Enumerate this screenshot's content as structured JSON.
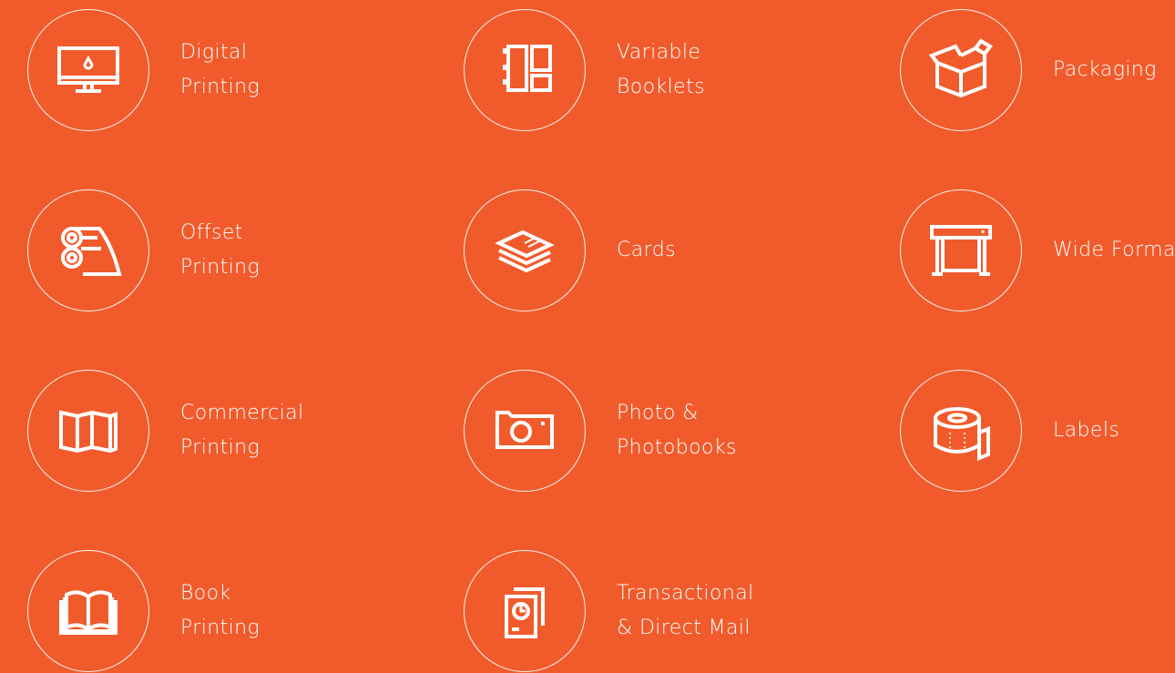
{
  "categories": [
    {
      "id": "digital-printing",
      "icon": "monitor-icon",
      "lines": [
        "Digital",
        "Printing"
      ]
    },
    {
      "id": "variable-booklets",
      "icon": "booklet-layout-icon",
      "lines": [
        "Variable",
        "Booklets"
      ]
    },
    {
      "id": "packaging",
      "icon": "box-icon",
      "lines": [
        "Packaging"
      ]
    },
    {
      "id": "offset-printing",
      "icon": "offset-rollers-icon",
      "lines": [
        "Offset",
        "Printing"
      ]
    },
    {
      "id": "cards",
      "icon": "card-stack-icon",
      "lines": [
        "Cards"
      ]
    },
    {
      "id": "wide-format",
      "icon": "wide-format-printer-icon",
      "lines": [
        "Wide Format"
      ]
    },
    {
      "id": "commercial-printing",
      "icon": "folded-map-icon",
      "lines": [
        "Commercial",
        "Printing"
      ]
    },
    {
      "id": "photo-photobooks",
      "icon": "camera-icon",
      "lines": [
        "Photo &",
        "Photobooks"
      ]
    },
    {
      "id": "labels",
      "icon": "label-roll-icon",
      "lines": [
        "Labels"
      ]
    },
    {
      "id": "book-printing",
      "icon": "open-book-icon",
      "lines": [
        "Book",
        "Printing"
      ]
    },
    {
      "id": "transactional-direct-mail",
      "icon": "mail-document-icon",
      "lines": [
        "Transactional",
        "& Direct Mail"
      ]
    }
  ],
  "colors": {
    "background": "#f15b2c",
    "foreground": "#ffffff"
  }
}
